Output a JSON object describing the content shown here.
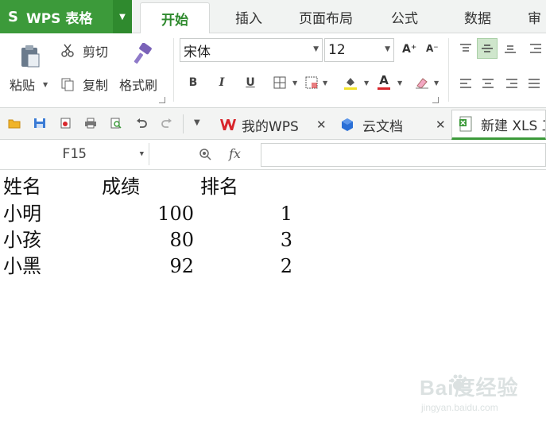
{
  "app": {
    "title": "WPS 表格",
    "logo_glyph": "S"
  },
  "menu_tabs": [
    "开始",
    "插入",
    "页面布局",
    "公式",
    "数据",
    "审"
  ],
  "ribbon": {
    "paste_label": "粘贴",
    "cut_label": "剪切",
    "copy_label": "复制",
    "format_painter_label": "格式刷",
    "font_name": "宋体",
    "font_size": "12",
    "bold": "B",
    "italic": "I",
    "underline": "U",
    "font_color_letter": "A",
    "grow_font": "A⁺",
    "shrink_font": "A⁻"
  },
  "doc_tabs": [
    {
      "label": "我的WPS",
      "closable": true
    },
    {
      "label": "云文档",
      "closable": true
    },
    {
      "label": "新建 XLS 工",
      "closable": false
    }
  ],
  "formula_bar": {
    "cell_ref": "F15",
    "fx": "fx",
    "value": ""
  },
  "sheet": {
    "headers": [
      "姓名",
      "成绩",
      "排名"
    ],
    "rows": [
      {
        "name": "小明",
        "score": "100",
        "rank": "1"
      },
      {
        "name": "小孩",
        "score": "80",
        "rank": "3"
      },
      {
        "name": "小黑",
        "score": "92",
        "rank": "2"
      }
    ]
  },
  "watermark": {
    "main": "Bai度经验",
    "sub": "jingyan.baidu.com"
  },
  "colors": {
    "brand_green": "#3c9a3a",
    "wps_red": "#d8262c",
    "cloud_blue": "#2a6fd6"
  }
}
